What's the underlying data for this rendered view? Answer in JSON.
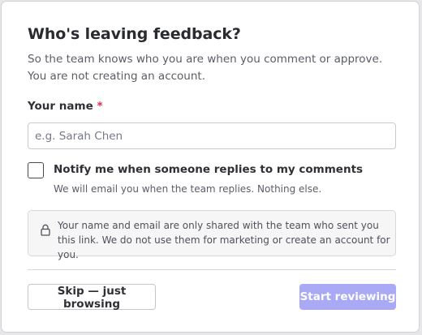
{
  "dialog": {
    "title": "Who's leaving feedback?",
    "subtitle": "So the team knows who you are when you comment or approve. You are not creating an account."
  },
  "name_field": {
    "label": "Your name",
    "required_marker": "*",
    "placeholder": "e.g. Sarah Chen",
    "value": ""
  },
  "notify": {
    "checked": false,
    "label": "Notify me when someone replies to my comments",
    "hint": "We will email you when the team replies. Nothing else."
  },
  "privacy_notice": {
    "icon": "lock-icon",
    "text": "Your name and email are only shared with the team who sent you this link. We do not use them for marketing or create an account for you."
  },
  "actions": {
    "skip_label": "Skip — just browsing",
    "start_label": "Start reviewing",
    "start_enabled": false
  },
  "colors": {
    "required": "#e0294a",
    "primary_disabled": "#aaa9f5"
  }
}
